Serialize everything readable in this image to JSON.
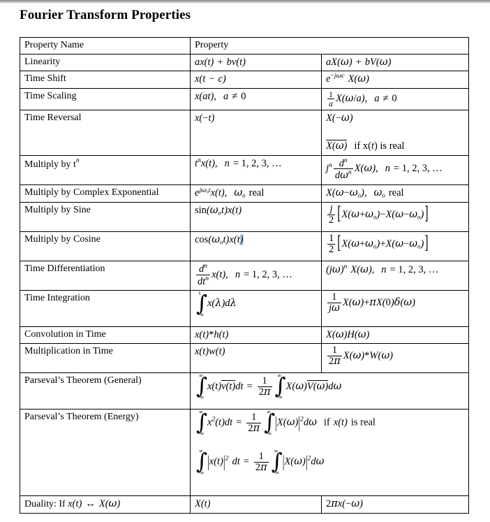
{
  "document": {
    "title": "Fourier Transform Properties"
  },
  "table": {
    "headers": {
      "col1": "Property Name",
      "col_merged": "Property"
    },
    "rows": [
      {
        "name": "Linearity",
        "time": "ax(t) + bv(t)",
        "freq": "aX(ω) + bV(ω)"
      },
      {
        "name": "Time Shift",
        "time": "x(t − c)",
        "freq": "e^(−jωc) X(ω)"
      },
      {
        "name": "Time Scaling",
        "time": "x(at),   a ≠ 0",
        "freq": "(1/a) X(ω/a),   a ≠ 0"
      },
      {
        "name": "Time Reversal",
        "time": "x(−t)",
        "freq_line1": "X(−ω)",
        "freq_line2": "conj[X(ω)]  if x(t) is real",
        "freq_line2_suffix": "if x(t) is real"
      },
      {
        "name": "Multiply by t^n",
        "name_base": "Multiply by t",
        "name_sup": "n",
        "time": "t^n x(t),   n = 1, 2, 3, …",
        "freq": "j^n (d^n/dω^n) X(ω),   n = 1, 2, 3, …"
      },
      {
        "name": "Multiply by Complex Exponential",
        "time": "e^(jωₒt) x(t),   ωₒ real",
        "freq": "X(ω − ωₒ),   ωₒ real"
      },
      {
        "name": "Multiply by Sine",
        "time": "sin(ωₒt)x(t)",
        "freq": "(j/2)[X(ω + ωₒ) − X(ω − ωₒ)]"
      },
      {
        "name": "Multiply by Cosine",
        "time": "cos(ωₒt)x(t)",
        "freq": "(1/2)[X(ω + ωₒ) + X(ω − ωₒ)]"
      },
      {
        "name": "Time Differentiation",
        "time": "(d^n/dt^n) x(t),   n = 1, 2, 3, …",
        "freq": "(jω)^n X(ω),   n = 1, 2, 3, …"
      },
      {
        "name": "Time Integration",
        "time": "∫ from −∞ to t  x(λ)dλ",
        "freq": "(1/jω) X(ω) + πX(0)δ(ω)"
      },
      {
        "name": "Convolution in Time",
        "time": "x(t) * h(t)",
        "freq": "X(ω)H(ω)"
      },
      {
        "name": "Multiplication in Time",
        "time": "x(t)w(t)",
        "freq": "(1/2π) X(ω) * W(ω)"
      },
      {
        "name": "Parseval’s Theorem (General)",
        "merged": "∫−∞⁺∞ x(t) conj[v(t)] dt = (1/2π) ∫−∞⁺∞ X(ω) conj[V(ω)] dω"
      },
      {
        "name": "Parseval’s Theorem (Energy)",
        "merged_line1": "∫−∞⁺∞ x²(t)dt = (1/2π) ∫−∞⁺∞ |X(ω)|² dω   if  x(t) is real",
        "merged_line1_note": "if  x(t)  is real",
        "merged_line2": "∫−∞⁺∞ |x(t)|² dt = (1/2π) ∫−∞⁺∞ |X(ω)|² dω"
      },
      {
        "name": "Duality: If x(t) ↔ X(ω)",
        "name_prefix": "Duality: If ",
        "time": "X(t)",
        "freq": "2πx(−ω)"
      }
    ]
  },
  "symbols": {
    "infinity": "∞",
    "neg_infinity": "−∞",
    "integral": "∫",
    "omega": "ω",
    "pi": "π",
    "delta": "δ",
    "lambda": "λ",
    "neq": "≠",
    "leftright_arrow": "↔",
    "ellipsis": "…",
    "minus": "−",
    "asterisk": "*"
  },
  "colors": {
    "text": "#000000",
    "border": "#000000",
    "background": "#ffffff",
    "selection": "#b5d0ea",
    "chrome": "#a9a9a9"
  }
}
